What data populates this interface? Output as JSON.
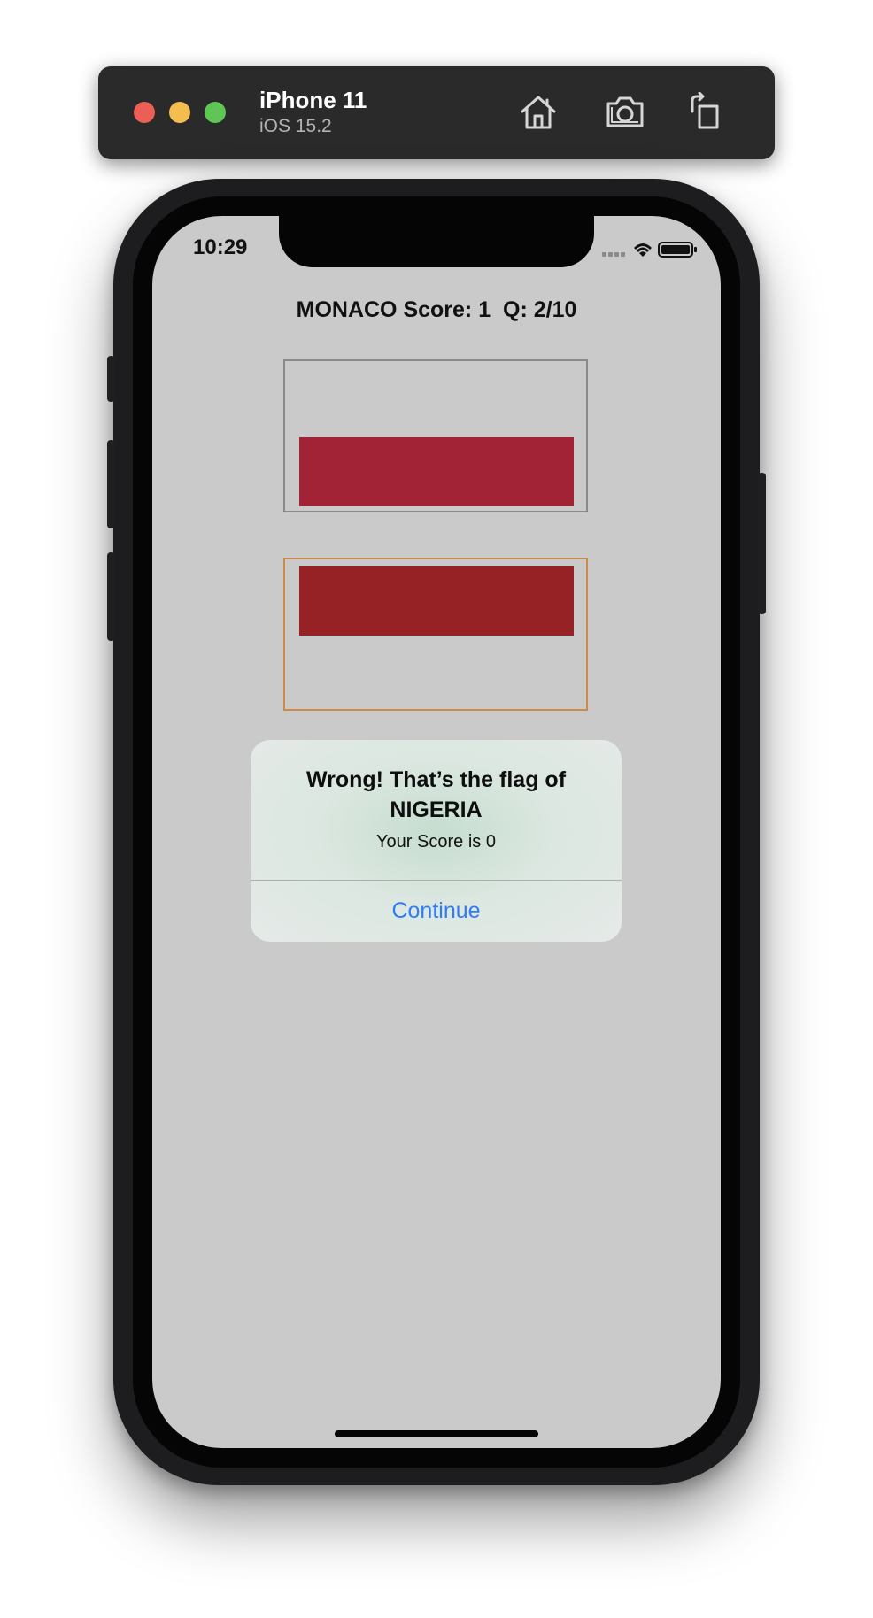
{
  "simulator": {
    "device_name": "iPhone 11",
    "os_version": "iOS 15.2",
    "toolbar_icons": [
      "home-icon",
      "screenshot-icon",
      "rotate-icon"
    ]
  },
  "status_bar": {
    "time": "10:29",
    "icons": [
      "cellular-icon",
      "wifi-icon",
      "battery-icon"
    ]
  },
  "quiz": {
    "header": "MONACO Score: 1  Q: 2/10",
    "flags": [
      {
        "name": "flag-option-1",
        "band_color": "#a12335",
        "band_position": "bottom"
      },
      {
        "name": "flag-option-2",
        "band_color": "#962225",
        "band_position": "top",
        "selected_border": "#cf8a46"
      }
    ]
  },
  "alert": {
    "title": "Wrong! That’s the flag of NIGERIA",
    "message": "Your Score is 0",
    "action": "Continue",
    "action_color": "#2f7cf6"
  }
}
